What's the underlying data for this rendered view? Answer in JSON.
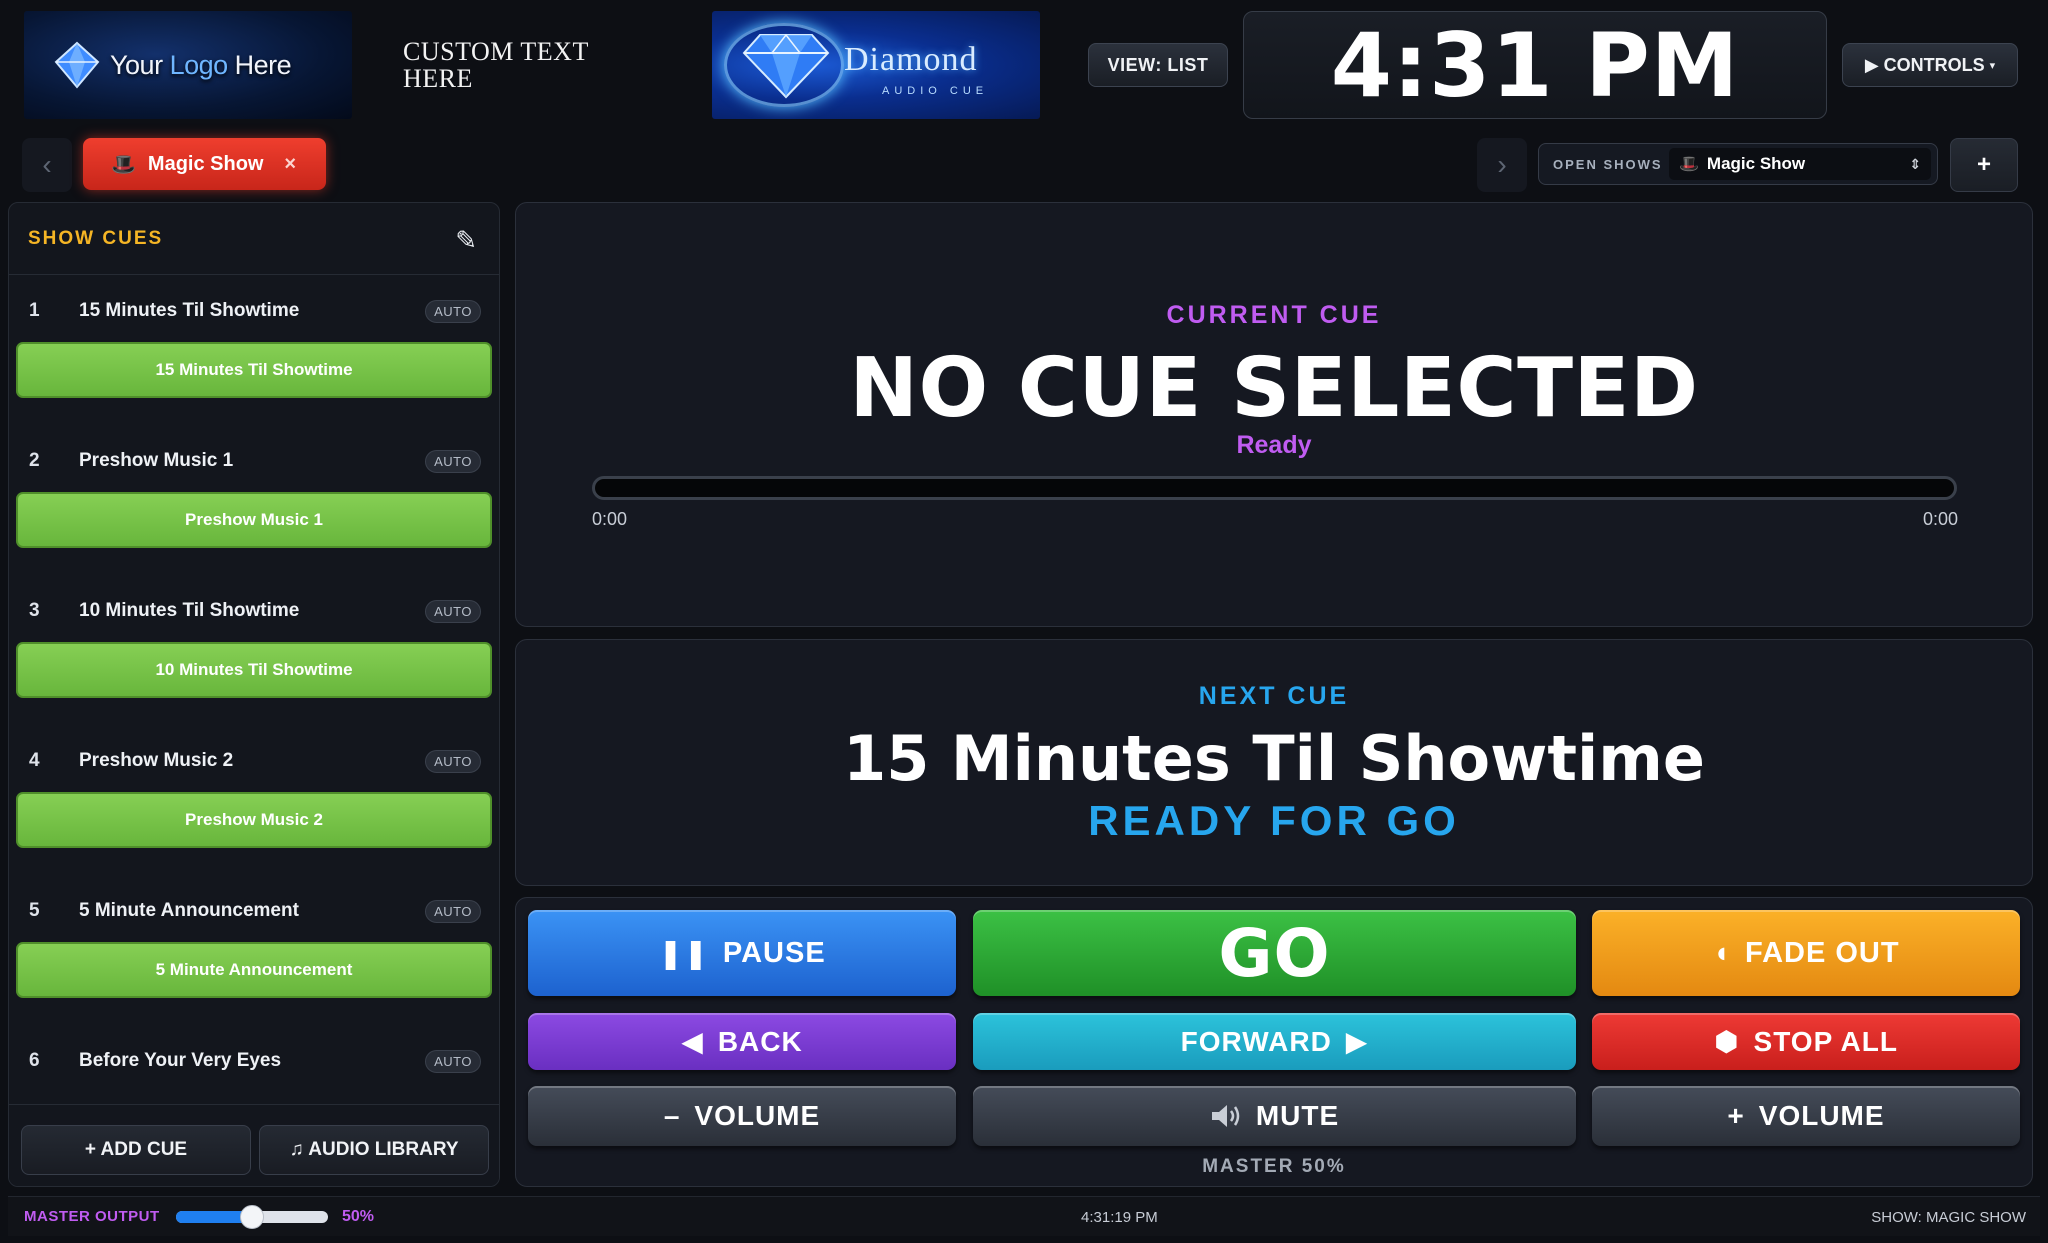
{
  "header": {
    "logo_text_a": "Your",
    "logo_text_b": "Logo",
    "logo_text_c": "Here",
    "custom_text": "CUSTOM TEXT HERE",
    "brand_name": "Diamond",
    "brand_sub": "AUDIO CUE",
    "view_button": "VIEW: LIST",
    "clock": "4:31 PM",
    "controls_button": "▶ CONTROLS",
    "controls_caret": "▾"
  },
  "tabs": {
    "prev_arrow": "‹",
    "next_arrow": "›",
    "active_tab": {
      "icon": "🎩",
      "label": "Magic Show",
      "close": "×"
    },
    "open_shows_label": "OPEN SHOWS",
    "open_shows_selected": {
      "icon": "🎩",
      "label": "Magic Show"
    },
    "add_button": "+"
  },
  "sidebar": {
    "title": "SHOW CUES",
    "cues": [
      {
        "num": "1",
        "name": "15 Minutes Til Showtime",
        "mode": "AUTO",
        "button": "15 Minutes Til Showtime"
      },
      {
        "num": "2",
        "name": "Preshow Music 1",
        "mode": "AUTO",
        "button": "Preshow Music 1"
      },
      {
        "num": "3",
        "name": "10 Minutes Til Showtime",
        "mode": "AUTO",
        "button": "10 Minutes Til Showtime"
      },
      {
        "num": "4",
        "name": "Preshow Music 2",
        "mode": "AUTO",
        "button": "Preshow Music 2"
      },
      {
        "num": "5",
        "name": "5 Minute Announcement",
        "mode": "AUTO",
        "button": "5 Minute Announcement"
      },
      {
        "num": "6",
        "name": "Before Your Very Eyes",
        "mode": "AUTO",
        "button": ""
      }
    ],
    "add_cue": "+ ADD CUE",
    "audio_library": "♫ AUDIO LIBRARY"
  },
  "current": {
    "label": "CURRENT CUE",
    "title": "NO CUE SELECTED",
    "status": "Ready",
    "progress": 0,
    "elapsed": "0:00",
    "remaining": "0:00"
  },
  "next": {
    "label": "NEXT CUE",
    "title": "15 Minutes Til Showtime",
    "status": "READY FOR GO"
  },
  "transport": {
    "pause": "PAUSE",
    "go": "GO",
    "fade_out": "FADE OUT",
    "back": "BACK",
    "forward": "FORWARD",
    "stop_all": "STOP ALL",
    "volume_down": "VOLUME",
    "mute": "MUTE",
    "volume_up": "VOLUME",
    "master_label": "MASTER 50%"
  },
  "statusbar": {
    "master_output_label": "MASTER OUTPUT",
    "master_level": 0.5,
    "master_pct": "50%",
    "time": "4:31:19 PM",
    "show": "SHOW: MAGIC SHOW"
  },
  "colors": {
    "accent_purple": "#c05cf1",
    "accent_blue": "#27a6ee",
    "title_gold": "#f5b525",
    "cue_green": "#76c448",
    "tab_red": "#e0352a"
  }
}
